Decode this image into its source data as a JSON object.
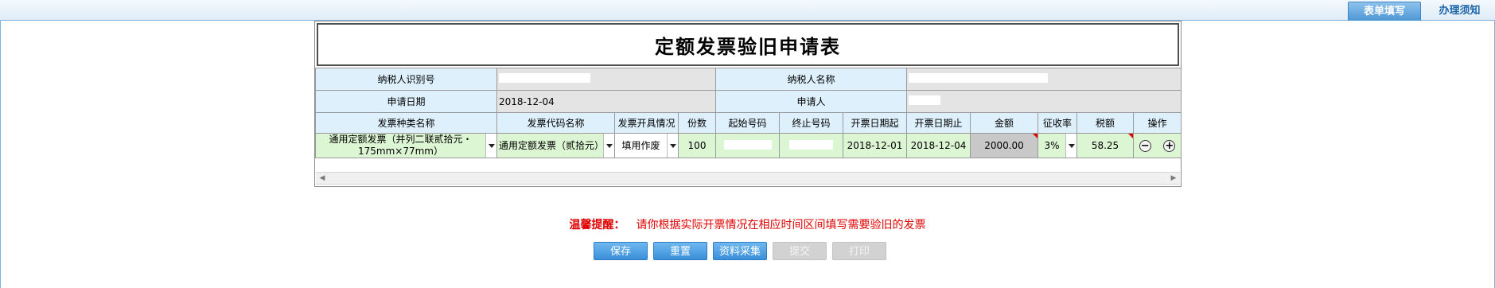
{
  "tabs": [
    {
      "label": "表单填写",
      "active": true
    },
    {
      "label": "办理须知",
      "active": false
    }
  ],
  "form": {
    "title": "定额发票验旧申请表",
    "taxpayer_id_label": "纳税人识别号",
    "taxpayer_name_label": "纳税人名称",
    "apply_date_label": "申请日期",
    "apply_date_value": "2018-12-04",
    "applicant_label": "申请人"
  },
  "table": {
    "headers": [
      "发票种类名称",
      "发票代码名称",
      "发票开具情况",
      "份数",
      "起始号码",
      "终止号码",
      "开票日期起",
      "开票日期止",
      "金额",
      "征收率",
      "税额",
      "操作"
    ],
    "row": {
      "invoice_type": "通用定额发票（并列二联贰拾元・175mm×77mm）",
      "invoice_code": "通用定额发票（贰拾元）",
      "issue_status": "填用作废",
      "copies": "100",
      "date_start": "2018-12-01",
      "date_end": "2018-12-04",
      "amount": "2000.00",
      "rate": "3%",
      "tax": "58.25"
    }
  },
  "reminder": {
    "tip_label": "温馨提醒：",
    "text": "请你根据实际开票情况在相应时间区间填写需要验旧的发票"
  },
  "buttons": {
    "save": "保存",
    "reset": "重置",
    "collect": "资料采集",
    "submit": "提交",
    "print": "打印"
  },
  "colors": {
    "accent": "#3a8fd9",
    "header_bg": "#def0fb",
    "input_bg": "#dcf5d2",
    "reminder": "#e00000"
  }
}
